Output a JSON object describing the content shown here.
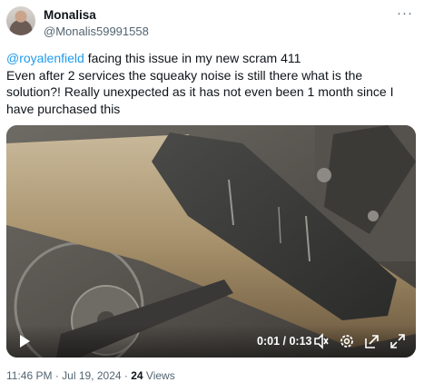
{
  "author": {
    "name": "Monalisa",
    "handle": "@Monalis59991558"
  },
  "tweet": {
    "mention": "@royalenfield",
    "text_line1": " facing this issue in my new scram 411",
    "text_rest": "Even after 2 services the squeaky noise is still there what is the solution?! Really unexpected as it has not even been 1 month since I have purchased this"
  },
  "video": {
    "time_current": "0:01",
    "time_separator": " / ",
    "time_total": "0:13",
    "icons": [
      "play-icon",
      "volume-icon",
      "settings-gear-icon",
      "exit-expand-icon",
      "fullscreen-icon"
    ]
  },
  "meta": {
    "time": "11:46 PM",
    "sep1": " · ",
    "date": "Jul 19, 2024",
    "sep2": " · ",
    "views_count": "24",
    "views_label": " Views"
  },
  "more_icon": "···"
}
